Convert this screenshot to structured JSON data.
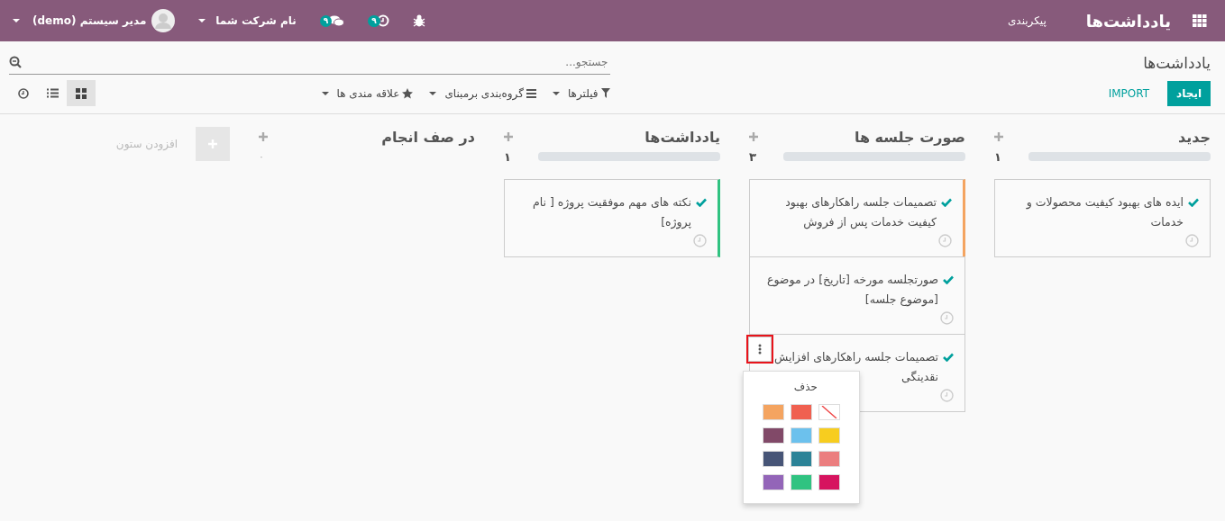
{
  "navbar": {
    "app_title": "یادداشت‌ها",
    "menus": [
      {
        "label": "پیکربندی"
      }
    ],
    "systray": [
      {
        "kind": "debug"
      },
      {
        "kind": "activity",
        "badge": "۹"
      },
      {
        "kind": "messages",
        "badge": "۹"
      },
      {
        "kind": "company",
        "label": "نام شرکت شما"
      },
      {
        "kind": "user",
        "label": "مدیر سیستم (demo)"
      }
    ]
  },
  "control_panel": {
    "breadcrumb": "یادداشت‌ها",
    "search": {
      "placeholder": "جستجو..."
    },
    "buttons": [
      {
        "kind": "primary",
        "label": "ایجاد"
      },
      {
        "kind": "link",
        "label": "IMPORT"
      }
    ],
    "filters": [
      {
        "kind": "filter",
        "label": "فیلترها"
      },
      {
        "kind": "groupby",
        "label": "گروه‌بندی برمبنای"
      },
      {
        "kind": "favorites",
        "label": "علاقه مندی ها"
      }
    ],
    "views": [
      {
        "kind": "kanban",
        "selected": true
      },
      {
        "kind": "list",
        "selected": false
      },
      {
        "kind": "activity",
        "selected": false
      }
    ]
  },
  "columns": [
    {
      "title": "جدید",
      "count": "۱",
      "level": 0,
      "cards": [
        {
          "title": "ایده های بهبود کیفیت محصولات و خدمات"
        }
      ]
    },
    {
      "title": "صورت جلسه ها",
      "count": "۳",
      "level": 0,
      "cards": [
        {
          "title": "تصمیمات جلسه راهکارهای بهبود کیفیت خدمات پس از فروش",
          "color": "#f4a460"
        },
        {
          "title": "صورتجلسه مورخه [تاریخ] در موضوع [موضوع جلسه]"
        },
        {
          "title": "تصمیمات جلسه راهکارهای افزایش نقدینگی",
          "menu": {
            "open": true,
            "highlighted": true,
            "delete_label": "حذف",
            "swatches": [
              {
                "kind": "none"
              },
              {
                "kind": "color",
                "color": "#f06050"
              },
              {
                "kind": "color",
                "color": "#f4a460"
              },
              {
                "kind": "color",
                "color": "#f7cd1f"
              },
              {
                "kind": "color",
                "color": "#6cc1ed"
              },
              {
                "kind": "color",
                "color": "#814968"
              },
              {
                "kind": "color",
                "color": "#eb7e7f"
              },
              {
                "kind": "color",
                "color": "#2c8397"
              },
              {
                "kind": "color",
                "color": "#475577"
              },
              {
                "kind": "color",
                "color": "#d6145f"
              },
              {
                "kind": "color",
                "color": "#30c381"
              },
              {
                "kind": "color",
                "color": "#9365b8"
              }
            ]
          }
        }
      ]
    },
    {
      "title": "یادداشت‌ها",
      "count": "۱",
      "level": 0,
      "cards": [
        {
          "title": "نکته های مهم موفقیت پروژه [ نام پروژه]",
          "color": "#30c381"
        }
      ]
    },
    {
      "title": "در صف انجام",
      "count": "۰"
    }
  ],
  "add_column": {
    "label": "افزودن ستون"
  }
}
